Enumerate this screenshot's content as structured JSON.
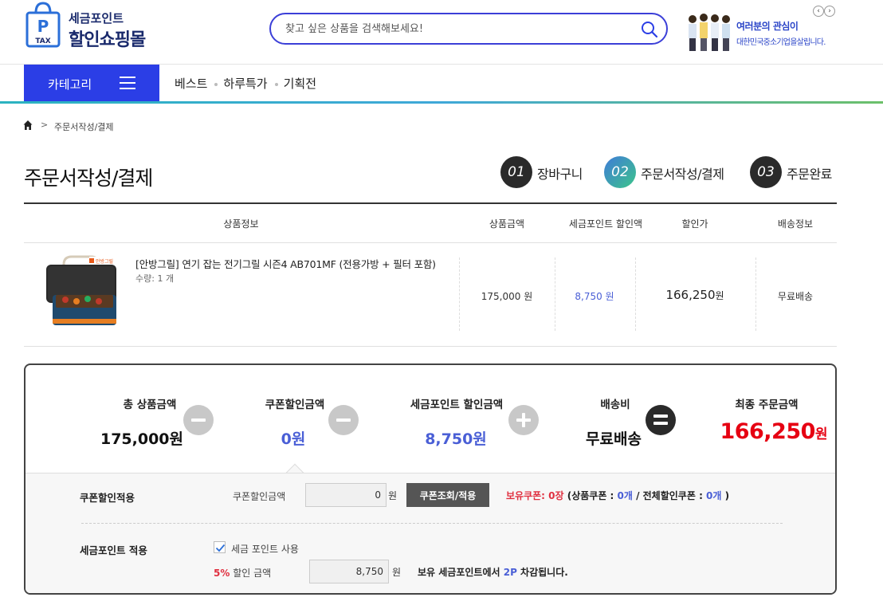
{
  "header": {
    "logo_badge": "TAX",
    "logo_line1": "세금포인트",
    "logo_line2": "할인쇼핑몰",
    "search_placeholder": "찾고 싶은 상품을 검색해보세요!",
    "banner_line1": "여러분의 관심이",
    "banner_line2": "대한민국중소기업을살립니다.",
    "banner_prev": "‹",
    "banner_next": "›"
  },
  "nav": {
    "category_label": "카테고리",
    "links": [
      "베스트",
      "하루특가",
      "기획전"
    ]
  },
  "breadcrumb": {
    "sep": ">",
    "current": "주문서작성/결제"
  },
  "page_title": "주문서작성/결제",
  "steps": [
    {
      "num": "01",
      "label": "장바구니"
    },
    {
      "num": "02",
      "label": "주문서작성/결제"
    },
    {
      "num": "03",
      "label": "주문완료"
    }
  ],
  "table": {
    "headers": [
      "상품정보",
      "상품금액",
      "세금포인트 할인액",
      "할인가",
      "배송정보"
    ],
    "item": {
      "name": "[안방그릴] 연기 잡는 전기그릴 시즌4 AB701MF (전용가방 + 필터 포함)",
      "qty": "수량: 1 개",
      "price": "175,000 원",
      "tax_discount": "8,750 원",
      "sale_price_num": "166,250",
      "sale_price_unit": "원",
      "shipping": "무료배송",
      "image_brand": "안방그릴"
    }
  },
  "summary": {
    "total_label": "총 상품금액",
    "total_value": "175,000원",
    "coupon_label": "쿠폰할인금액",
    "coupon_value": "0원",
    "tax_label": "세금포인트 할인금액",
    "tax_value": "8,750원",
    "ship_label": "배송비",
    "ship_value": "무료배송",
    "final_label": "최종 주문금액",
    "final_num": "166,250",
    "final_unit": "원"
  },
  "coupon": {
    "row_label": "쿠폰할인적용",
    "field_label": "쿠폰할인금액",
    "input_value": "0",
    "unit": "원",
    "button": "쿠폰조회/적용",
    "owned_label": "보유쿠폰: ",
    "owned_count": "0장",
    "detail_open": " (상품쿠폰 : ",
    "product_count": "0개",
    "detail_mid": " / 전체할인쿠폰 : ",
    "all_count": "0개",
    "detail_close": " )"
  },
  "tax_point": {
    "row_label": "세금포인트 적용",
    "checkbox_label": "세금 포인트 사용",
    "checked": true,
    "rate": "5%",
    "amount_label": " 할인 금액",
    "input_value": "8,750",
    "unit": "원",
    "note_pre": "보유 세금포인트에서 ",
    "note_points": "2P",
    "note_post": " 차감됩니다."
  },
  "colors": {
    "brand_blue": "#2b3ee6",
    "discount_blue": "#4a5fd6",
    "final_red": "#e60012",
    "search_border": "#3b3fd8"
  }
}
